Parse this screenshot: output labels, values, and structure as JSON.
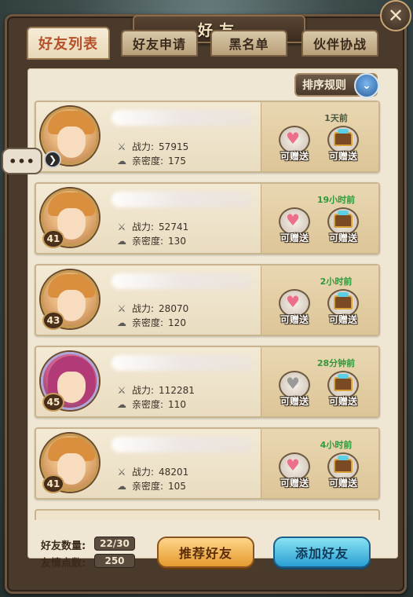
{
  "header": {
    "title": "好友"
  },
  "tabs": [
    {
      "label": "好友列表",
      "active": true
    },
    {
      "label": "好友申请",
      "active": false
    },
    {
      "label": "黑名单",
      "active": false
    },
    {
      "label": "伙伴协战",
      "active": false
    }
  ],
  "sort": {
    "label": "排序规则"
  },
  "chat": {
    "label": "•••"
  },
  "stats_labels": {
    "power": "战力:",
    "intimacy": "亲密度:"
  },
  "gift_label": "可赠送",
  "friends": [
    {
      "level": "",
      "power": "57915",
      "intimacy": "175",
      "last_online": "1天前",
      "avatar": "blonde",
      "heart_available": true
    },
    {
      "level": "41",
      "power": "52741",
      "intimacy": "130",
      "last_online": "19小时前",
      "avatar": "blonde",
      "heart_available": true
    },
    {
      "level": "43",
      "power": "28070",
      "intimacy": "120",
      "last_online": "2小时前",
      "avatar": "blonde",
      "heart_available": true
    },
    {
      "level": "45",
      "power": "112281",
      "intimacy": "110",
      "last_online": "28分钟前",
      "avatar": "pink",
      "heart_available": false
    },
    {
      "level": "41",
      "power": "48201",
      "intimacy": "105",
      "last_online": "4小时前",
      "avatar": "blonde",
      "heart_available": true
    }
  ],
  "footer": {
    "friend_count_label": "好友数量:",
    "friend_count_value": "22/30",
    "friendship_points_label": "友情点数:",
    "friendship_points_value": "250",
    "recommend_button": "推荐好友",
    "add_button": "添加好友"
  },
  "colors": {
    "time_green": "#2f9a3a",
    "heart_pink": "#ef6f8a",
    "tab_active_text": "#b4502a"
  },
  "icons": {
    "power": "crossed-swords-icon",
    "intimacy": "cloud-icon",
    "heart_gift": "heart-icon",
    "chest_gift": "treasure-chest-icon",
    "close": "close-icon",
    "sort": "chevron-down-icon"
  }
}
